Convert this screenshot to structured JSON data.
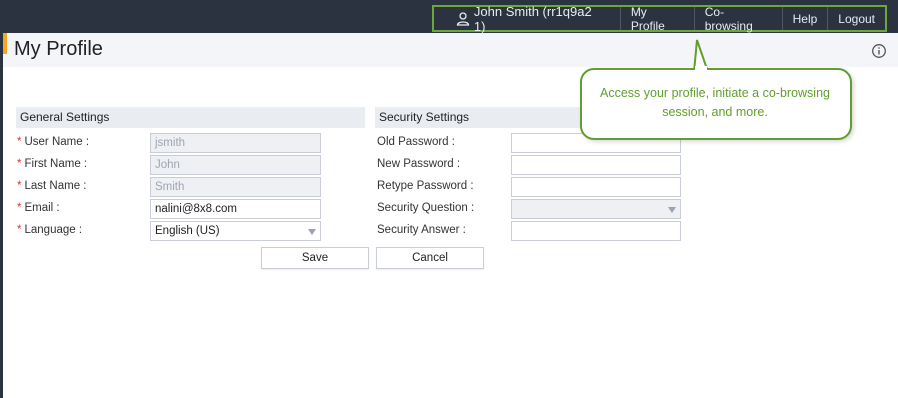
{
  "topbar": {
    "user": {
      "icon": "user-icon",
      "name": "John Smith (rr1q9a2 1)"
    },
    "links": [
      "My Profile",
      "Co-browsing",
      "Help",
      "Logout"
    ]
  },
  "page": {
    "title": "My Profile",
    "info_icon": "info-icon"
  },
  "general": {
    "header": "General Settings",
    "fields": [
      {
        "label": "User Name :",
        "required": "*",
        "value": "jsmith"
      },
      {
        "label": "First Name :",
        "required": "*",
        "value": "John"
      },
      {
        "label": "Last Name :",
        "required": "*",
        "value": "Smith"
      },
      {
        "label": "Email :",
        "required": "*",
        "value": "nalini@8x8.com"
      },
      {
        "label": "Language :",
        "required": "*",
        "value": "English (US)"
      }
    ]
  },
  "security": {
    "header": "Security Settings",
    "fields": [
      {
        "label": "Old Password :",
        "value": ""
      },
      {
        "label": "New Password :",
        "value": ""
      },
      {
        "label": "Retype Password :",
        "value": ""
      },
      {
        "label": "Security Question :",
        "value": ""
      },
      {
        "label": "Security Answer :",
        "value": ""
      }
    ]
  },
  "buttons": {
    "save": "Save",
    "cancel": "Cancel"
  },
  "tooltip": {
    "text": "Access your profile, initiate a co-browsing session, and more."
  },
  "colors": {
    "topbar": "#2b3340",
    "accent": "#f5a623",
    "callout": "#5f9e2f",
    "required": "#d23b2b"
  }
}
